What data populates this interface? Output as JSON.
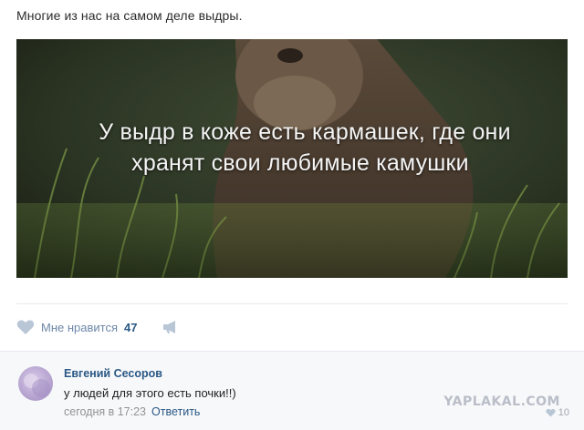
{
  "post": {
    "text": "Многие из нас на самом деле выдры.",
    "image_caption_line1": "У выдр в коже есть кармашек, где они",
    "image_caption_line2": "хранят свои любимые камушки"
  },
  "actions": {
    "like_label": "Мне нравится",
    "like_count": "47",
    "like_icon": "heart-icon",
    "share_icon": "megaphone-icon"
  },
  "comment": {
    "author": "Евгений Сесоров",
    "text": "у людей для этого есть почки!!)",
    "time": "сегодня в 17:23",
    "reply_label": "Ответить",
    "likes": "10"
  },
  "watermark": "YAPLAKAL.COM",
  "colors": {
    "link": "#2a5885",
    "muted": "#939393",
    "like_label": "#6d87a8",
    "divider": "#e6e9ee",
    "comment_bg": "#f7f8fa"
  }
}
